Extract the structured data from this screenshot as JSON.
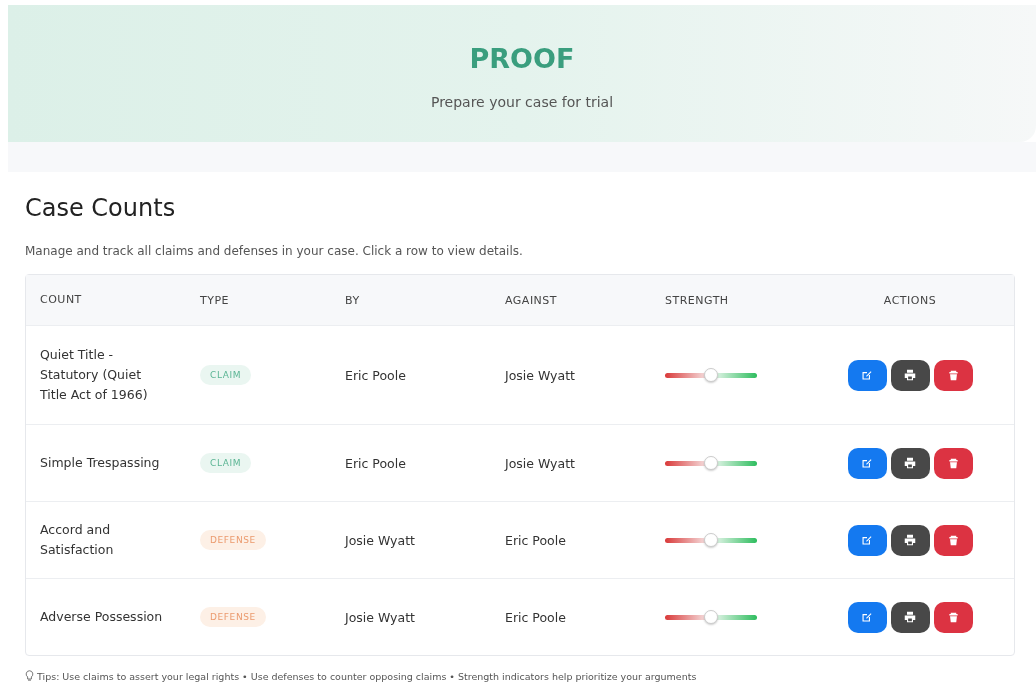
{
  "header": {
    "title": "PROOF",
    "subtitle": "Prepare your case for trial"
  },
  "section": {
    "title": "Case Counts",
    "description": "Manage and track all claims and defenses in your case. Click a row to view details."
  },
  "table": {
    "columns": [
      "COUNT",
      "TYPE",
      "BY",
      "AGAINST",
      "STRENGTH",
      "ACTIONS"
    ],
    "rows": [
      {
        "count": "Quiet Title - Statutory (Quiet Title Act of 1966)",
        "type": {
          "label": "CLAIM",
          "kind": "claim"
        },
        "by": "Eric Poole",
        "against": "Josie Wyatt",
        "strength": {
          "level": 0.5
        }
      },
      {
        "count": "Simple Trespassing",
        "type": {
          "label": "CLAIM",
          "kind": "claim"
        },
        "by": "Eric Poole",
        "against": "Josie Wyatt",
        "strength": {
          "level": 0.5
        }
      },
      {
        "count": "Accord and Satisfaction",
        "type": {
          "label": "DEFENSE",
          "kind": "defense"
        },
        "by": "Josie Wyatt",
        "against": "Eric Poole",
        "strength": {
          "level": 0.5
        }
      },
      {
        "count": "Adverse Possession",
        "type": {
          "label": "DEFENSE",
          "kind": "defense"
        },
        "by": "Josie Wyatt",
        "against": "Eric Poole",
        "strength": {
          "level": 0.5
        }
      }
    ]
  },
  "tips": "Tips: Use claims to assert your legal rights • Use defenses to counter opposing claims • Strength indicators help prioritize your arguments"
}
